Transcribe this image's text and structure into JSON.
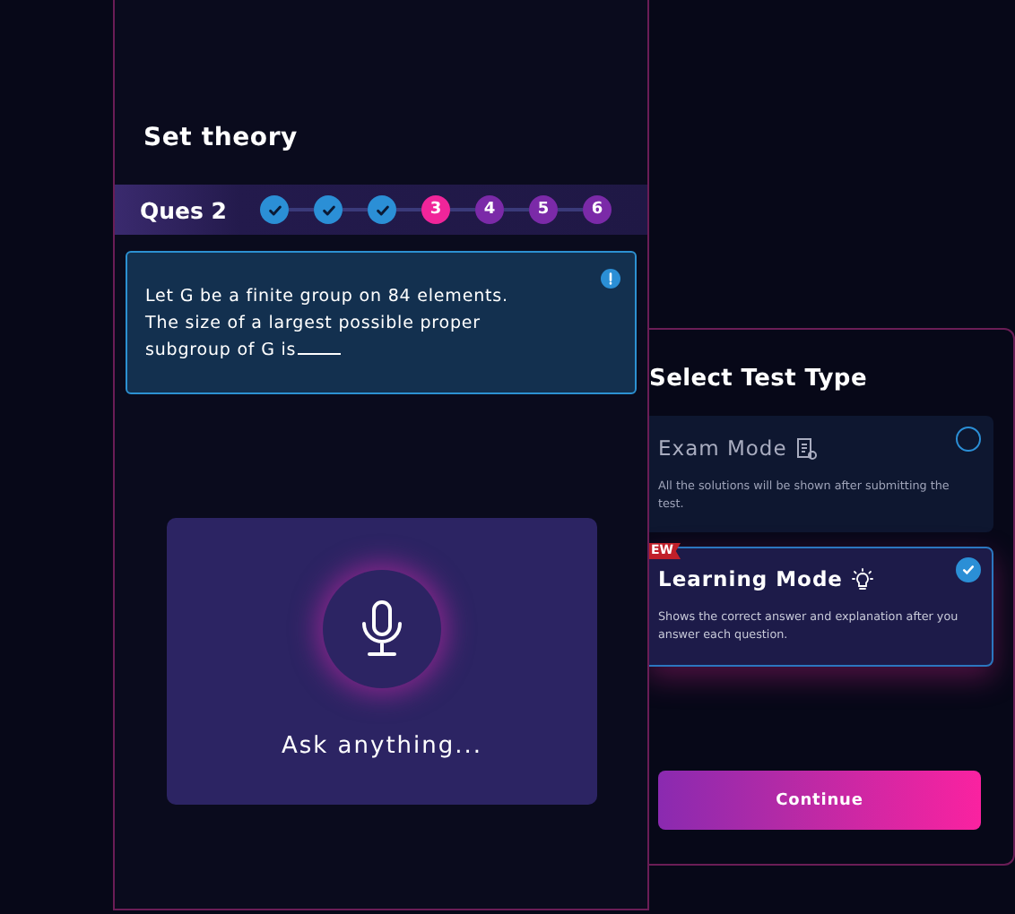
{
  "quiz": {
    "title": "Set theory",
    "question_label": "Ques 2",
    "steps": [
      {
        "kind": "done"
      },
      {
        "kind": "done"
      },
      {
        "kind": "done"
      },
      {
        "label": "3",
        "kind": "current"
      },
      {
        "label": "4",
        "kind": "upcoming"
      },
      {
        "label": "5",
        "kind": "upcoming"
      },
      {
        "label": "6",
        "kind": "upcoming"
      }
    ],
    "question": "Let G be a finite group on 84 elements. The size of a largest possible proper subgroup of G is",
    "voice_prompt": "Ask anything..."
  },
  "test_type": {
    "title": "Select Test Type",
    "options": [
      {
        "title": "Exam Mode",
        "description": "All the solutions will be shown after submitting the test.",
        "selected": false
      },
      {
        "title": "Learning Mode",
        "badge": "EW",
        "description": "Shows the correct answer and explanation after you answer each question.",
        "selected": true
      }
    ],
    "button": "Continue"
  }
}
